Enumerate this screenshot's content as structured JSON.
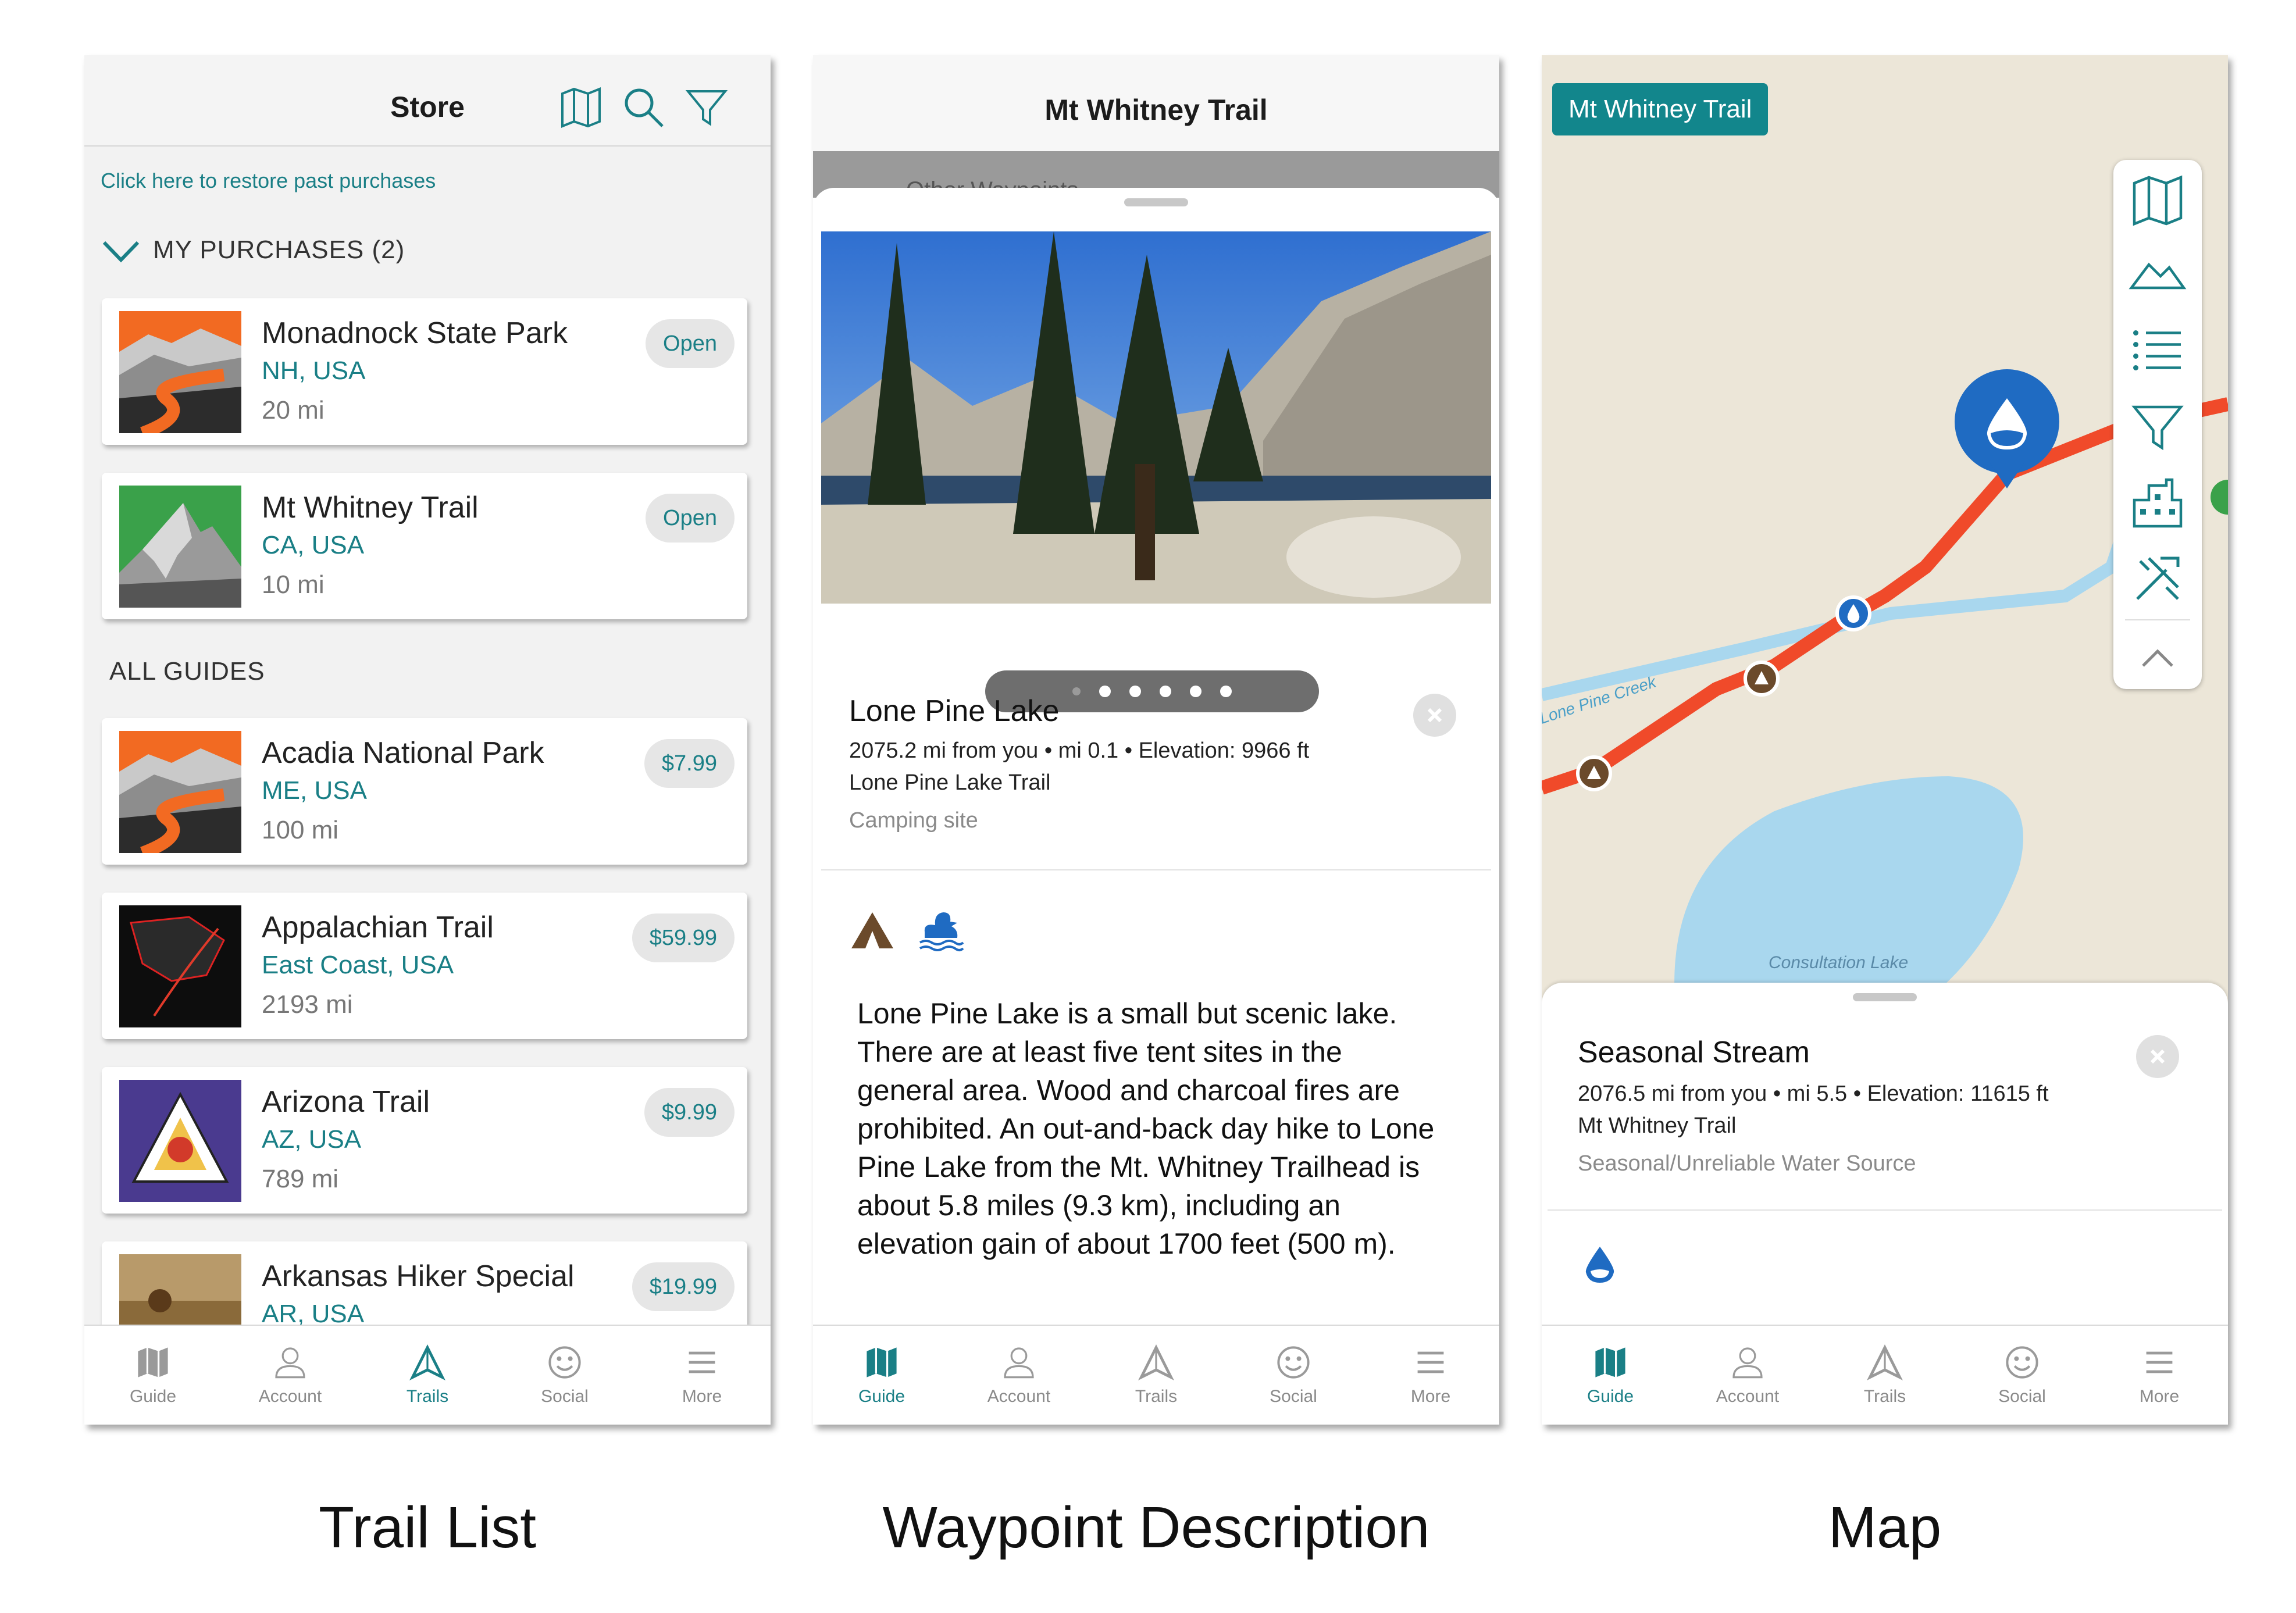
{
  "captions": {
    "trail_list": "Trail List",
    "waypoint": "Waypoint Description",
    "map": "Map"
  },
  "tabs": [
    {
      "label": "Guide"
    },
    {
      "label": "Account"
    },
    {
      "label": "Trails"
    },
    {
      "label": "Social"
    },
    {
      "label": "More"
    }
  ],
  "store": {
    "title": "Store",
    "restore_link": "Click here to restore past purchases",
    "my_purchases_label": "MY PURCHASES (2)",
    "all_guides_label": "ALL GUIDES",
    "purchases": [
      {
        "name": "Monadnock State Park",
        "location": "NH, USA",
        "distance": "20 mi",
        "action": "Open"
      },
      {
        "name": "Mt Whitney Trail",
        "location": "CA, USA",
        "distance": "10 mi",
        "action": "Open"
      }
    ],
    "guides": [
      {
        "name": "Acadia National Park",
        "location": "ME, USA",
        "distance": "100 mi",
        "price": "$7.99"
      },
      {
        "name": "Appalachian Trail",
        "location": "East Coast, USA",
        "distance": "2193 mi",
        "price": "$59.99"
      },
      {
        "name": "Arizona Trail",
        "location": "AZ, USA",
        "distance": "789 mi",
        "price": "$9.99"
      },
      {
        "name": "Arkansas Hiker Special",
        "location": "AR, USA",
        "price": "$19.99"
      }
    ],
    "active_tab": "Trails"
  },
  "waypoint": {
    "header_title": "Mt Whitney Trail",
    "behind_text": "Other Waypoints",
    "name": "Lone Pine Lake",
    "meta": "2075.2 mi from you • mi 0.1 • Elevation: 9966 ft",
    "trail": "Lone Pine Lake Trail",
    "type": "Camping site",
    "photo_count": 6,
    "description": "Lone Pine Lake is a small but scenic lake. There are at least five tent sites in the general area. Wood and charcoal fires are prohibited. An out-and-back day hike to Lone Pine Lake from the Mt. Whitney Trailhead is about 5.8 miles (9.3 km), including an elevation gain of about 1700 feet (500 m).",
    "icons": [
      "tent-icon",
      "duck-icon"
    ],
    "active_tab": "Guide"
  },
  "map": {
    "trail_tag": "Mt Whitney Trail",
    "creek_label": "Lone Pine Creek",
    "lake_label": "Consultation Lake",
    "waypoint_name": "Seasonal Stream",
    "meta": "2076.5 mi from you • mi 5.5 • Elevation: 11615 ft",
    "trail": "Mt Whitney Trail",
    "type": "Seasonal/Unreliable Water Source",
    "toolbar_icons": [
      "map-icon",
      "elevation-icon",
      "list-icon",
      "filter-icon",
      "town-icon",
      "tools-icon",
      "collapse-icon"
    ],
    "active_tab": "Guide"
  },
  "colors": {
    "accent": "#1a7f86",
    "trail_line": "#f04a2a",
    "creek": "#a8d8ec",
    "water_pin": "#1f6bc2",
    "map_bg": "#ece6d8"
  }
}
